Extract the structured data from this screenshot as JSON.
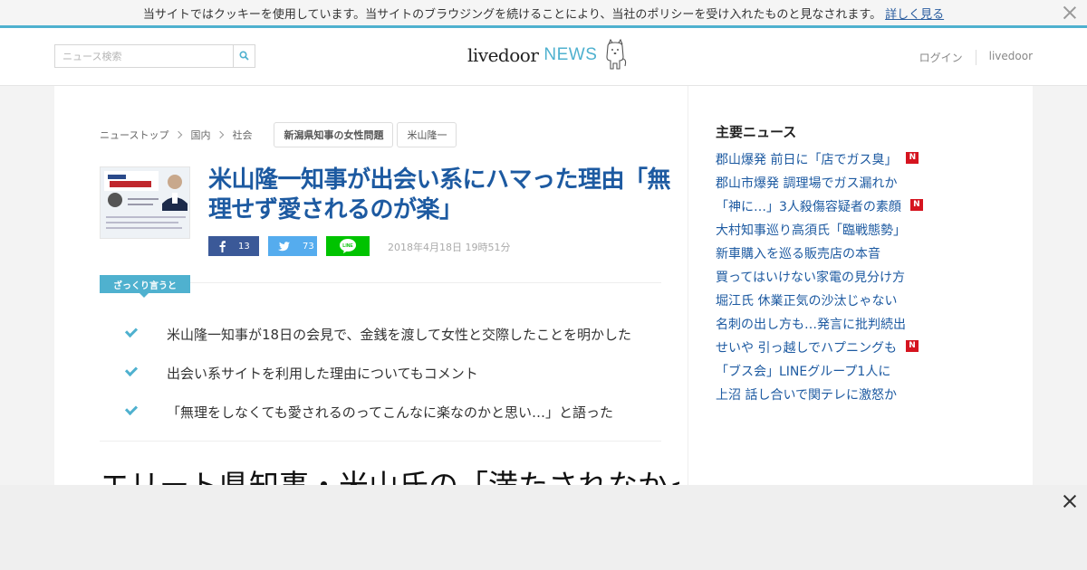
{
  "cookie": {
    "text": "当サイトではクッキーを使用しています。当サイトのブラウジングを続けることにより、当社のポリシーを受け入れたものと見なされます。",
    "link": "詳しく見る"
  },
  "header": {
    "search_placeholder": "ニュース検索",
    "logo_main": "livedoor",
    "logo_news": "NEWS",
    "login": "ログイン",
    "livedoor": "livedoor"
  },
  "breadcrumb": {
    "items": [
      "ニューストップ",
      "国内",
      "社会"
    ],
    "tags": [
      "新潟県知事の女性問題",
      "米山隆一"
    ]
  },
  "article": {
    "title": "米山隆一知事が出会い系にハマった理由「無理せず愛されるのが楽」",
    "facebook_count": "13",
    "twitter_count": "73",
    "line_label": "LINE",
    "date": "2018年4月18日 19時51分",
    "summary_label": "ざっくり言うと",
    "points": [
      "米山隆一知事が18日の会見で、金銭を渡して女性と交際したことを明かした",
      "出会い系サイトを利用した理由についてもコメント",
      "「無理をしなくても愛されるのってこんなに楽なのかと思い…」と語った"
    ],
    "headline2": "エリート県知事・米山氏の「満たされなかっ"
  },
  "sidebar": {
    "title": "主要ニュース",
    "new_label": "N",
    "items": [
      {
        "text": "郡山爆発 前日に「店でガス臭」",
        "new": true
      },
      {
        "text": "郡山市爆発 調理場でガス漏れか",
        "new": false
      },
      {
        "text": "「神に…」3人殺傷容疑者の素顔",
        "new": true
      },
      {
        "text": "大村知事巡り高須氏「臨戦態勢」",
        "new": false
      },
      {
        "text": "新車購入を巡る販売店の本音",
        "new": false
      },
      {
        "text": "買ってはいけない家電の見分け方",
        "new": false
      },
      {
        "text": "堀江氏 休業正気の沙汰じゃない",
        "new": false
      },
      {
        "text": "名刺の出し方も…発言に批判続出",
        "new": false
      },
      {
        "text": "せいや 引っ越しでハプニングも",
        "new": true
      },
      {
        "text": "「ブス会」LINEグループ1人に",
        "new": false
      },
      {
        "text": "上沼 話し合いで関テレに激怒か",
        "new": false
      }
    ]
  },
  "colors": {
    "accent": "#4fb1cf",
    "link": "#1d5aa1",
    "facebook": "#3b5998",
    "twitter": "#55acee",
    "line": "#00c300",
    "new_badge": "#d5141f"
  }
}
